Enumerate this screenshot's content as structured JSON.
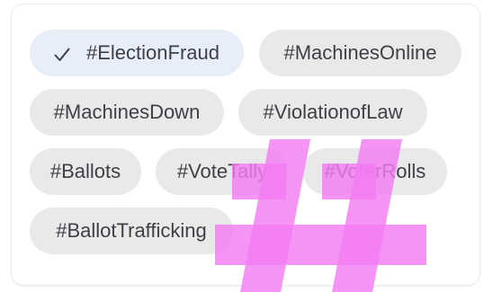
{
  "filter_chips": [
    {
      "label": "#ElectionFraud",
      "selected": true
    },
    {
      "label": "#MachinesOnline",
      "selected": false
    },
    {
      "label": "#MachinesDown",
      "selected": false
    },
    {
      "label": "#ViolationofLaw",
      "selected": false
    },
    {
      "label": "#Ballots",
      "selected": false
    },
    {
      "label": "#VoteTally",
      "selected": false
    },
    {
      "label": "#VoterRolls",
      "selected": false
    },
    {
      "label": "#BallotTrafficking",
      "selected": false
    }
  ],
  "icons": {
    "check": "check-icon",
    "overlay": "hashtag-icon"
  },
  "colors": {
    "chip_bg": "#e9e9e9",
    "chip_selected_bg": "#e7eef8",
    "chip_text": "#3f3f46",
    "overlay_magenta": "#f37cf3"
  }
}
